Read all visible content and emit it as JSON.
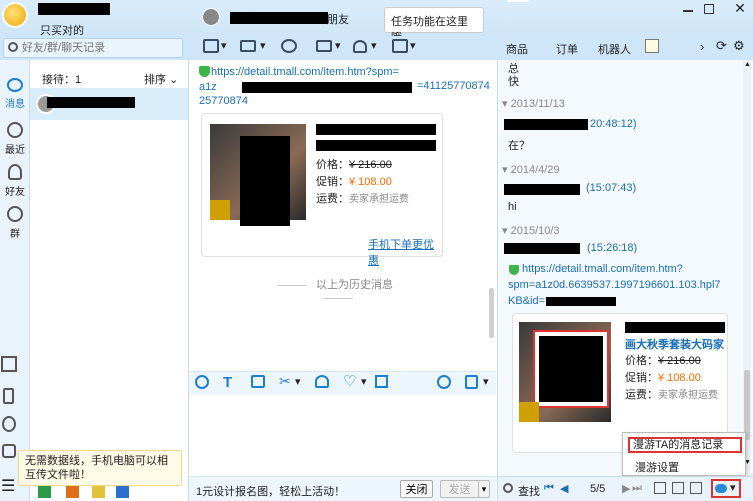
{
  "app": {
    "status_text": "只买对的",
    "search_placeholder": "好友/群/聊天记录",
    "contact_suffix": "朋友",
    "tooltip": "任务功能在这里哦"
  },
  "right_tabs": [
    "商品",
    "订单",
    "机器人"
  ],
  "left_nav": [
    {
      "icon": "message-icon",
      "label": "消息"
    },
    {
      "icon": "clock-icon",
      "label": "最近"
    },
    {
      "icon": "friend-icon",
      "label": "好友"
    },
    {
      "icon": "group-icon",
      "label": "群"
    }
  ],
  "sessions": {
    "reception": "接待：1",
    "sort": "排序"
  },
  "chat": {
    "link_text": "https://detail.tmall.com/item.htm?spm=a1z",
    "link_tail": "=41125770874",
    "price_label": "价格：",
    "price": "¥ 216.00",
    "promo_label": "促销：",
    "promo_price": "¥ 108.00",
    "shipping_label": "运费：",
    "shipping_value": "卖家承担运费",
    "mobile_order": "手机下单更优惠",
    "history_divider": "以上为历史消息",
    "footer_ad": "1元设计报名图，轻松上活动！",
    "close_btn": "关闭",
    "send_btn": "发送"
  },
  "history": {
    "line1": "总",
    "line2": "快",
    "entries": [
      {
        "date": "2013/11/13",
        "time": "20:48:12)",
        "msg": "在？"
      },
      {
        "date": "2014/4/29",
        "time": "(15:07:43)",
        "msg": "hi"
      },
      {
        "date": "2015/10/3",
        "time": "(15:26:18)",
        "msg": ""
      }
    ],
    "link_line1": "https://detail.tmall.com/item.htm?",
    "link_line2": "spm=a1z0d.6639537.1997196601.103.hpl7",
    "link_line3": "KB&id=",
    "card_title2": "画大秋季套装大码家",
    "price_label": "价格：",
    "price": "¥ 216.00",
    "promo_label": "促销：",
    "promo_price": "¥ 108.00",
    "shipping_label": "运费：",
    "shipping_value": "卖家承担运费",
    "menu_item1": "漫游TA的消息记录",
    "menu_item2": "漫游设置",
    "find": "查找",
    "page": "5/5"
  },
  "tip": {
    "text": "无需数据线，手机电脑可以相互传文件啦！"
  }
}
